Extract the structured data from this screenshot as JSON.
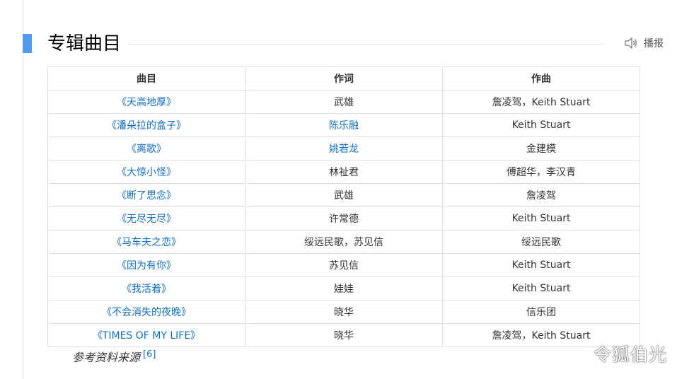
{
  "section": {
    "title": "专辑曲目",
    "play_label": "播报",
    "accent_color": "#4f9cee"
  },
  "table": {
    "headers": [
      "曲目",
      "作词",
      "作曲"
    ],
    "rows": [
      {
        "song": "《天高地厚》",
        "lyricist": "武雄",
        "composer": "詹凌驾，Keith Stuart",
        "lyricist_link": false
      },
      {
        "song": "《潘朵拉的盒子》",
        "lyricist": "陈乐融",
        "composer": "Keith Stuart",
        "lyricist_link": true
      },
      {
        "song": "《离歌》",
        "lyricist": "姚若龙",
        "composer": "金建模",
        "lyricist_link": true
      },
      {
        "song": "《大惊小怪》",
        "lyricist": "林祉君",
        "composer": "傅超华，李汉青",
        "lyricist_link": false
      },
      {
        "song": "《断了思念》",
        "lyricist": "武雄",
        "composer": "詹凌驾",
        "lyricist_link": false
      },
      {
        "song": "《无尽无尽》",
        "lyricist": "许常德",
        "composer": "Keith Stuart",
        "lyricist_link": false
      },
      {
        "song": "《马车夫之恋》",
        "lyricist": "绥远民歌，苏见信",
        "composer": "绥远民歌",
        "lyricist_link": false
      },
      {
        "song": "《因为有你》",
        "lyricist": "苏见信",
        "composer": "Keith Stuart",
        "lyricist_link": false
      },
      {
        "song": "《我活着》",
        "lyricist": "娃娃",
        "composer": "Keith Stuart",
        "lyricist_link": false
      },
      {
        "song": "《不会消失的夜晚》",
        "lyricist": "晓华",
        "composer": "信乐团",
        "lyricist_link": false
      },
      {
        "song": "《TIMES OF MY LIFE》",
        "lyricist": "晓华",
        "composer": "詹凌驾，Keith Stuart",
        "lyricist_link": false
      }
    ]
  },
  "reference": {
    "text": "参考资料来源",
    "marker": "[6]"
  },
  "watermark": "令狐伯光",
  "icons": {
    "play": "speaker-icon"
  },
  "colors": {
    "link": "#136ec2",
    "border": "#e0e0e0"
  }
}
